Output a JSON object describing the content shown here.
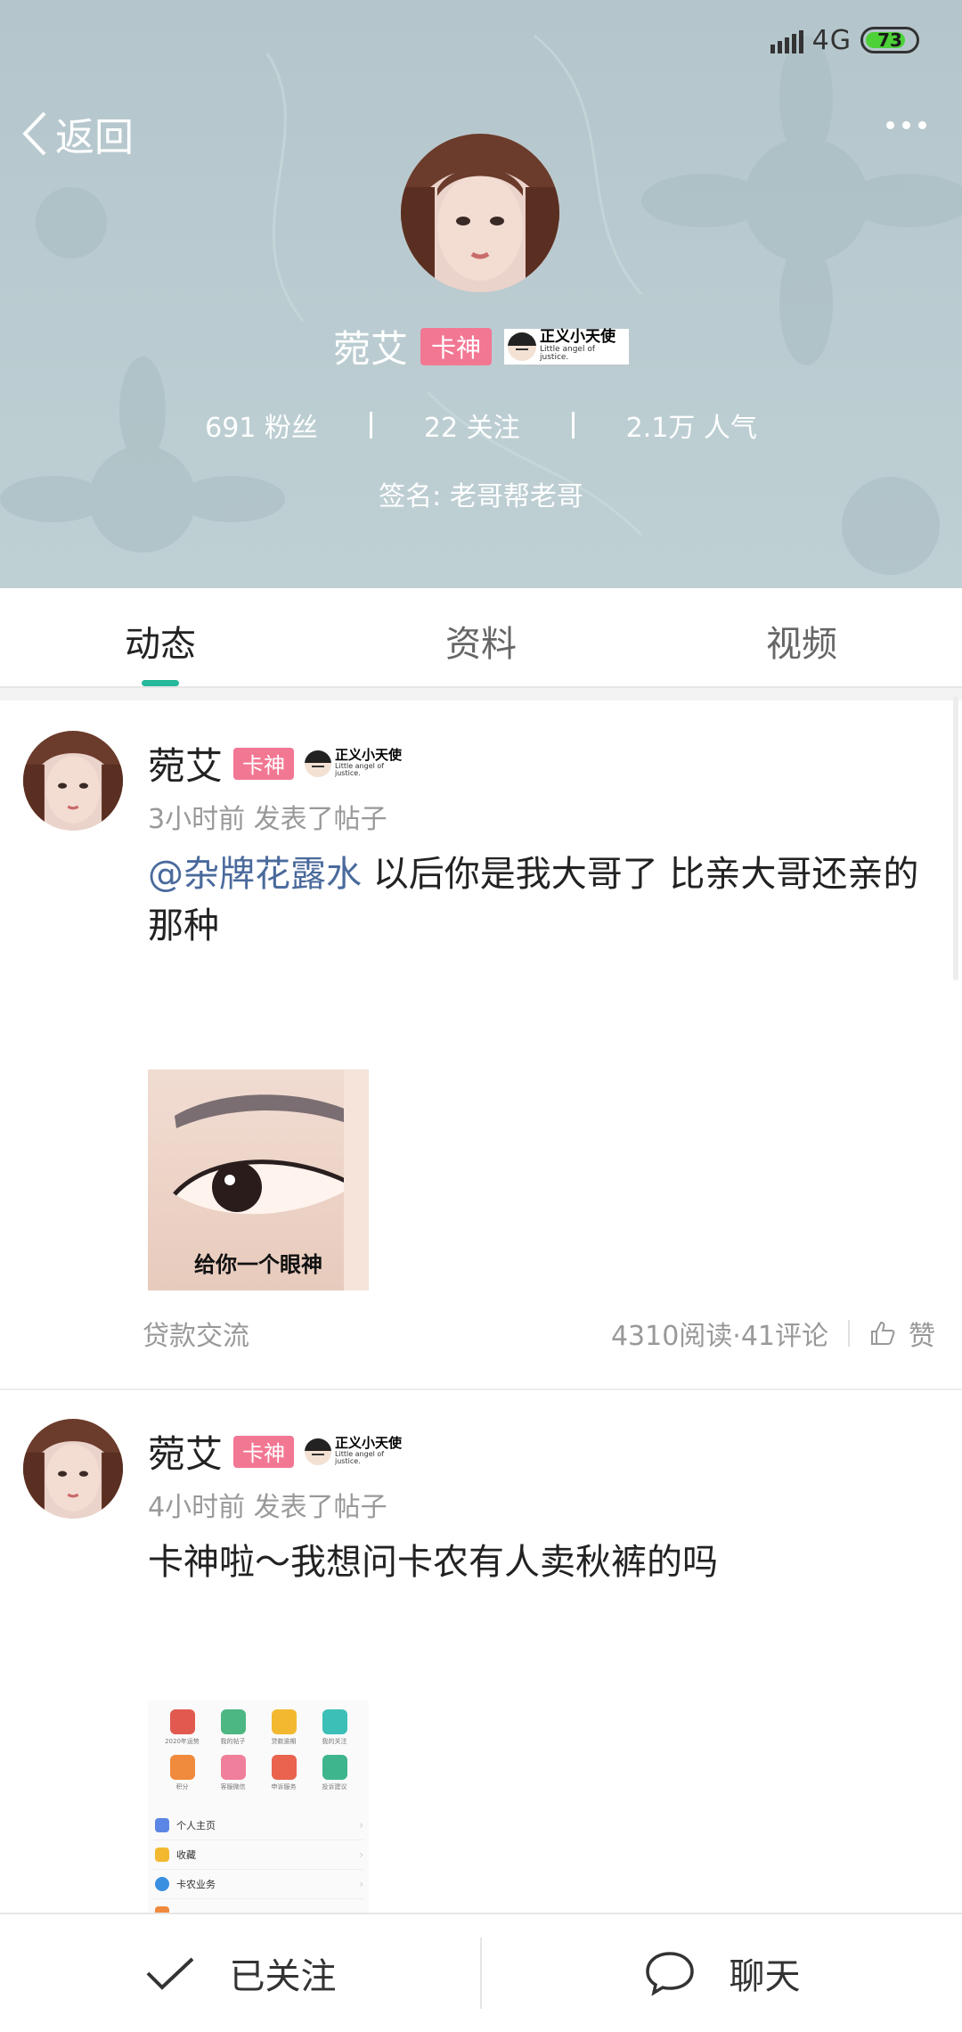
{
  "status_bar": {
    "network": "4G",
    "battery": "73"
  },
  "nav": {
    "back_label": "返回"
  },
  "profile": {
    "name": "菀艾",
    "badge": "卡神",
    "medal_title": "正义小天使",
    "medal_subtitle": "Little angel of justice.",
    "followers": "691 粉丝",
    "following": "22 关注",
    "popularity": "2.1万 人气",
    "signature": "签名: 老哥帮老哥"
  },
  "tabs": [
    {
      "label": "动态",
      "active": true
    },
    {
      "label": "资料",
      "active": false
    },
    {
      "label": "视频",
      "active": false
    }
  ],
  "posts": [
    {
      "name": "菀艾",
      "badge": "卡神",
      "medal_title": "正义小天使",
      "medal_subtitle": "Little angel of justice.",
      "meta": "3小时前  发表了帖子",
      "mention": "@杂牌花露水",
      "text": " 以后你是我大哥了 比亲大哥还亲的那种",
      "image_caption": "给你一个眼神",
      "forum": "贷款交流",
      "stats": "4310阅读·41评论",
      "like_label": "赞"
    },
    {
      "name": "菀艾",
      "badge": "卡神",
      "medal_title": "正义小天使",
      "medal_subtitle": "Little angel of justice.",
      "meta": "4小时前  发表了帖子",
      "text": "卡神啦～我想问卡农有人卖秋裤的吗",
      "thumb_grid": [
        "2020年运势",
        "我的帖子",
        "贷款逾期",
        "我的关注",
        "积分",
        "客服微信",
        "申诉服务",
        "投诉建议"
      ],
      "thumb_list": [
        "个人主页",
        "收藏",
        "卡农业务"
      ]
    }
  ],
  "bottom": {
    "follow_label": "已关注",
    "chat_label": "聊天"
  },
  "colors": {
    "accent": "#26b89a",
    "badge": "#f27793",
    "mention": "#4a6a9c",
    "header_bg": "#b9cbd0"
  }
}
